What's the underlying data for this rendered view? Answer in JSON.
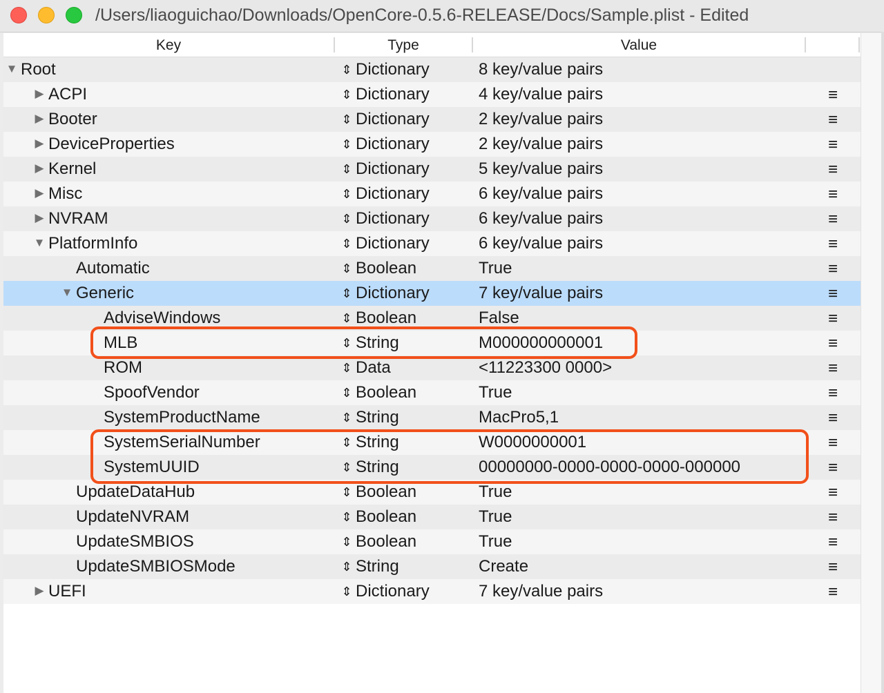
{
  "window": {
    "title": "/Users/liaoguichao/Downloads/OpenCore-0.5.6-RELEASE/Docs/Sample.plist - Edited"
  },
  "columns": {
    "key": "Key",
    "type": "Type",
    "value": "Value"
  },
  "icons": {
    "disclosure_collapsed": "disclosure-triangle-right-icon",
    "disclosure_expanded": "disclosure-triangle-down-icon",
    "type_stepper": "up-down-arrows-icon",
    "row_menu": "hamburger-menu-icon"
  },
  "colors": {
    "selection": "#bcdcfb",
    "annotation": "#f2501b"
  },
  "rows": [
    {
      "key": "Root",
      "type": "Dictionary",
      "value": "8 key/value pairs",
      "indent": 0,
      "disclosure": "expanded",
      "menu": ""
    },
    {
      "key": "ACPI",
      "type": "Dictionary",
      "value": "4 key/value pairs",
      "indent": 1,
      "disclosure": "collapsed",
      "menu": "≡"
    },
    {
      "key": "Booter",
      "type": "Dictionary",
      "value": "2 key/value pairs",
      "indent": 1,
      "disclosure": "collapsed",
      "menu": "≡"
    },
    {
      "key": "DeviceProperties",
      "type": "Dictionary",
      "value": "2 key/value pairs",
      "indent": 1,
      "disclosure": "collapsed",
      "menu": "≡"
    },
    {
      "key": "Kernel",
      "type": "Dictionary",
      "value": "5 key/value pairs",
      "indent": 1,
      "disclosure": "collapsed",
      "menu": "≡"
    },
    {
      "key": "Misc",
      "type": "Dictionary",
      "value": "6 key/value pairs",
      "indent": 1,
      "disclosure": "collapsed",
      "menu": "≡"
    },
    {
      "key": "NVRAM",
      "type": "Dictionary",
      "value": "6 key/value pairs",
      "indent": 1,
      "disclosure": "collapsed",
      "menu": "≡"
    },
    {
      "key": "PlatformInfo",
      "type": "Dictionary",
      "value": "6 key/value pairs",
      "indent": 1,
      "disclosure": "expanded",
      "menu": "≡"
    },
    {
      "key": "Automatic",
      "type": "Boolean",
      "value": "True",
      "indent": 2,
      "disclosure": "none",
      "menu": "≡"
    },
    {
      "key": "Generic",
      "type": "Dictionary",
      "value": "7 key/value pairs",
      "indent": 2,
      "disclosure": "expanded",
      "menu": "≡",
      "selected": true
    },
    {
      "key": "AdviseWindows",
      "type": "Boolean",
      "value": "False",
      "indent": 3,
      "disclosure": "none",
      "menu": "≡"
    },
    {
      "key": "MLB",
      "type": "String",
      "value": "M000000000001",
      "indent": 3,
      "disclosure": "none",
      "menu": "≡"
    },
    {
      "key": "ROM",
      "type": "Data",
      "value": "<11223300 0000>",
      "indent": 3,
      "disclosure": "none",
      "menu": "≡"
    },
    {
      "key": "SpoofVendor",
      "type": "Boolean",
      "value": "True",
      "indent": 3,
      "disclosure": "none",
      "menu": "≡"
    },
    {
      "key": "SystemProductName",
      "type": "String",
      "value": "MacPro5,1",
      "indent": 3,
      "disclosure": "none",
      "menu": "≡"
    },
    {
      "key": "SystemSerialNumber",
      "type": "String",
      "value": "W0000000001",
      "indent": 3,
      "disclosure": "none",
      "menu": "≡"
    },
    {
      "key": "SystemUUID",
      "type": "String",
      "value": "00000000-0000-0000-0000-000000",
      "indent": 3,
      "disclosure": "none",
      "menu": "≡"
    },
    {
      "key": "UpdateDataHub",
      "type": "Boolean",
      "value": "True",
      "indent": 2,
      "disclosure": "none",
      "menu": "≡"
    },
    {
      "key": "UpdateNVRAM",
      "type": "Boolean",
      "value": "True",
      "indent": 2,
      "disclosure": "none",
      "menu": "≡"
    },
    {
      "key": "UpdateSMBIOS",
      "type": "Boolean",
      "value": "True",
      "indent": 2,
      "disclosure": "none",
      "menu": "≡"
    },
    {
      "key": "UpdateSMBIOSMode",
      "type": "String",
      "value": "Create",
      "indent": 2,
      "disclosure": "none",
      "menu": "≡"
    },
    {
      "key": "UEFI",
      "type": "Dictionary",
      "value": "7 key/value pairs",
      "indent": 1,
      "disclosure": "collapsed",
      "menu": "≡"
    }
  ]
}
